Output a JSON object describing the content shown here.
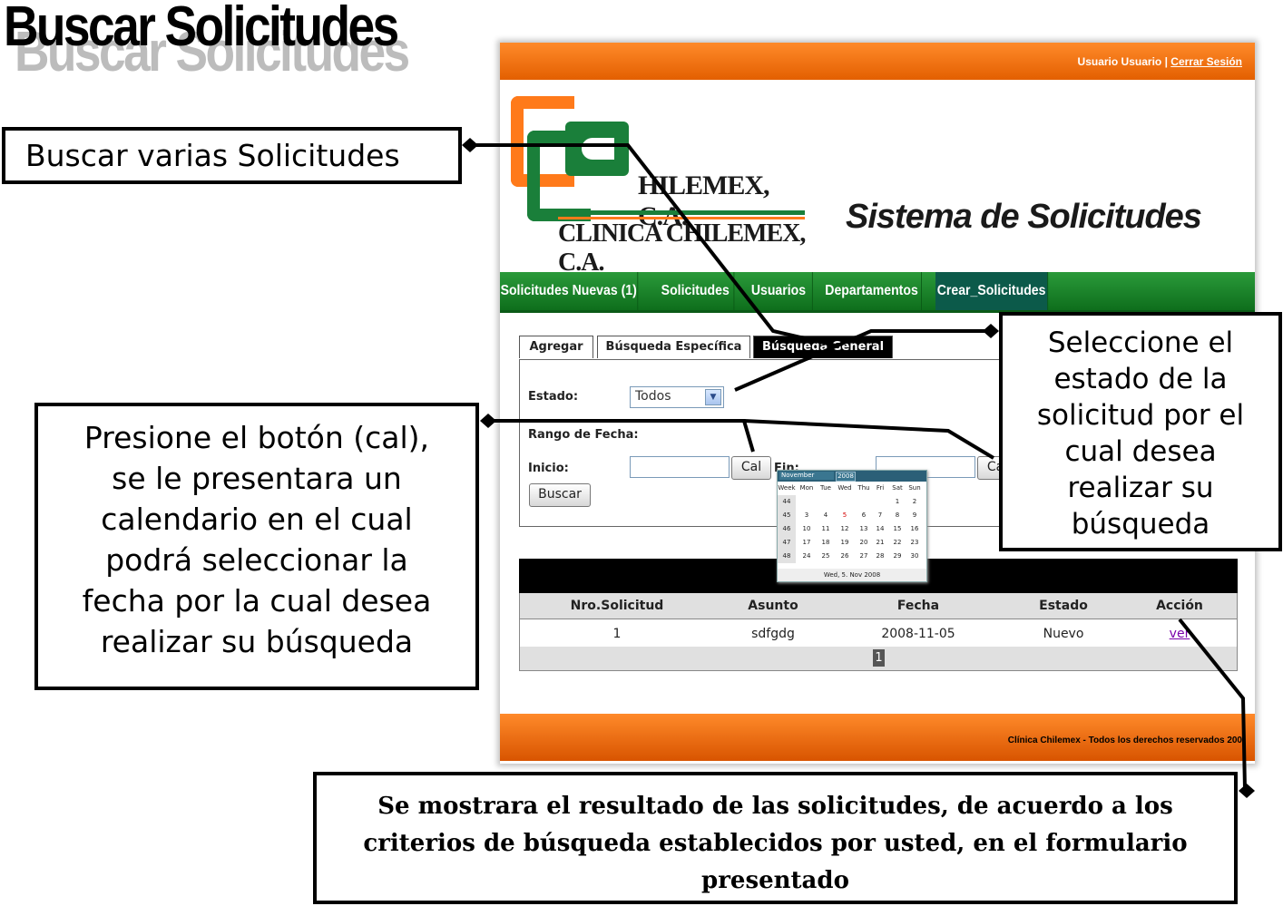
{
  "doc_title": "Buscar Solicitudes",
  "app": {
    "user_label": "Usuario Usuario",
    "separator": "|",
    "logout_label": "Cerrar Sesión",
    "logo_line1": "HILEMEX, C.A.",
    "logo_line2": "CLINICA CHILEMEX, C.A.",
    "title": "Sistema de Solicitudes",
    "nav": [
      "Solicitudes Nuevas (1)",
      "Solicitudes",
      "Usuarios",
      "Departamentos",
      "Crear_Solicitudes"
    ],
    "tabs": [
      "Agregar",
      "Búsqueda Específica",
      "Búsqueda General"
    ],
    "form": {
      "estado_label": "Estado:",
      "estado_value": "Todos",
      "rango_label": "Rango de Fecha:",
      "inicio_label": "Inicio:",
      "fin_label": "Fin:",
      "cal_button": "Cal",
      "buscar_button": "Buscar"
    },
    "calendar": {
      "month": "November",
      "year": "2008",
      "headers": [
        "Week",
        "Mon",
        "Tue",
        "Wed",
        "Thu",
        "Fri",
        "Sat",
        "Sun"
      ],
      "rows": [
        [
          "44",
          "",
          "",
          "",
          "",
          "",
          "1",
          "2"
        ],
        [
          "45",
          "3",
          "4",
          "5",
          "6",
          "7",
          "8",
          "9"
        ],
        [
          "46",
          "10",
          "11",
          "12",
          "13",
          "14",
          "15",
          "16"
        ],
        [
          "47",
          "17",
          "18",
          "19",
          "20",
          "21",
          "22",
          "23"
        ],
        [
          "48",
          "24",
          "25",
          "26",
          "27",
          "28",
          "29",
          "30"
        ]
      ],
      "footer": "Wed, 5. Nov 2008"
    },
    "results": {
      "columns": [
        "Nro.Solicitud",
        "Asunto",
        "Fecha",
        "Estado",
        "Acción"
      ],
      "rows": [
        [
          "1",
          "sdfgdg",
          "2008-11-05",
          "Nuevo",
          "ver"
        ]
      ],
      "page": "1"
    },
    "footer": "Clínica Chilemex - Todos los derechos reservados 200"
  },
  "callouts": {
    "buscar_varias": "Buscar varias Solicitudes",
    "presione": [
      "Presione el botón (cal),",
      "se le presentara un",
      "calendario en el cual",
      "podrá seleccionar la",
      "fecha por la cual desea",
      "realizar su búsqueda"
    ],
    "seleccione": [
      "Seleccione el",
      "estado de la",
      "solicitud por el",
      "cual desea",
      "realizar su",
      "búsqueda"
    ],
    "resultado": [
      "Se mostrara el resultado de las solicitudes, de acuerdo a los",
      "criterios de búsqueda establecidos por usted, en el formulario",
      "presentado"
    ]
  },
  "colors": {
    "orange": "#e86a10",
    "green": "#1a7f3a",
    "nav_active": "#0c5a4a",
    "link": "#7a00aa"
  }
}
